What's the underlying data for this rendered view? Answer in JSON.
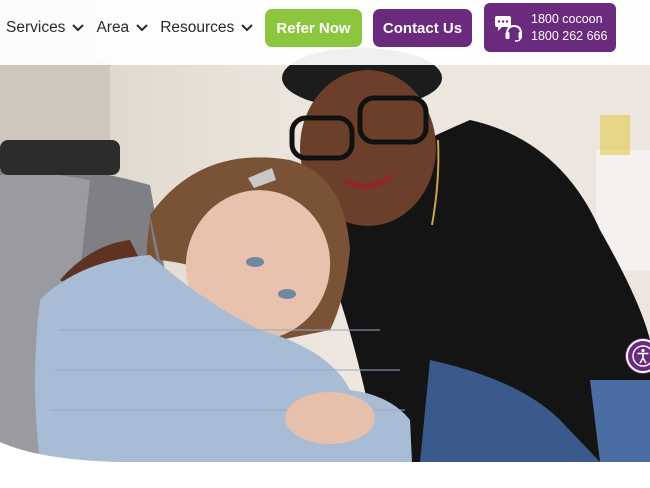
{
  "nav": {
    "items": [
      {
        "label": "Services"
      },
      {
        "label": "Area"
      },
      {
        "label": "Resources"
      }
    ]
  },
  "buttons": {
    "refer_label": "Refer Now",
    "contact_label": "Contact Us"
  },
  "phone": {
    "line1": "1800 cocoon",
    "line2": "1800 262 666",
    "icon": "chat-headset-icon"
  },
  "accessibility": {
    "icon": "accessibility-icon"
  },
  "colors": {
    "brand_purple": "#6a2a7e",
    "brand_green": "#8cc63f",
    "nav_text": "#2a2a2a"
  }
}
